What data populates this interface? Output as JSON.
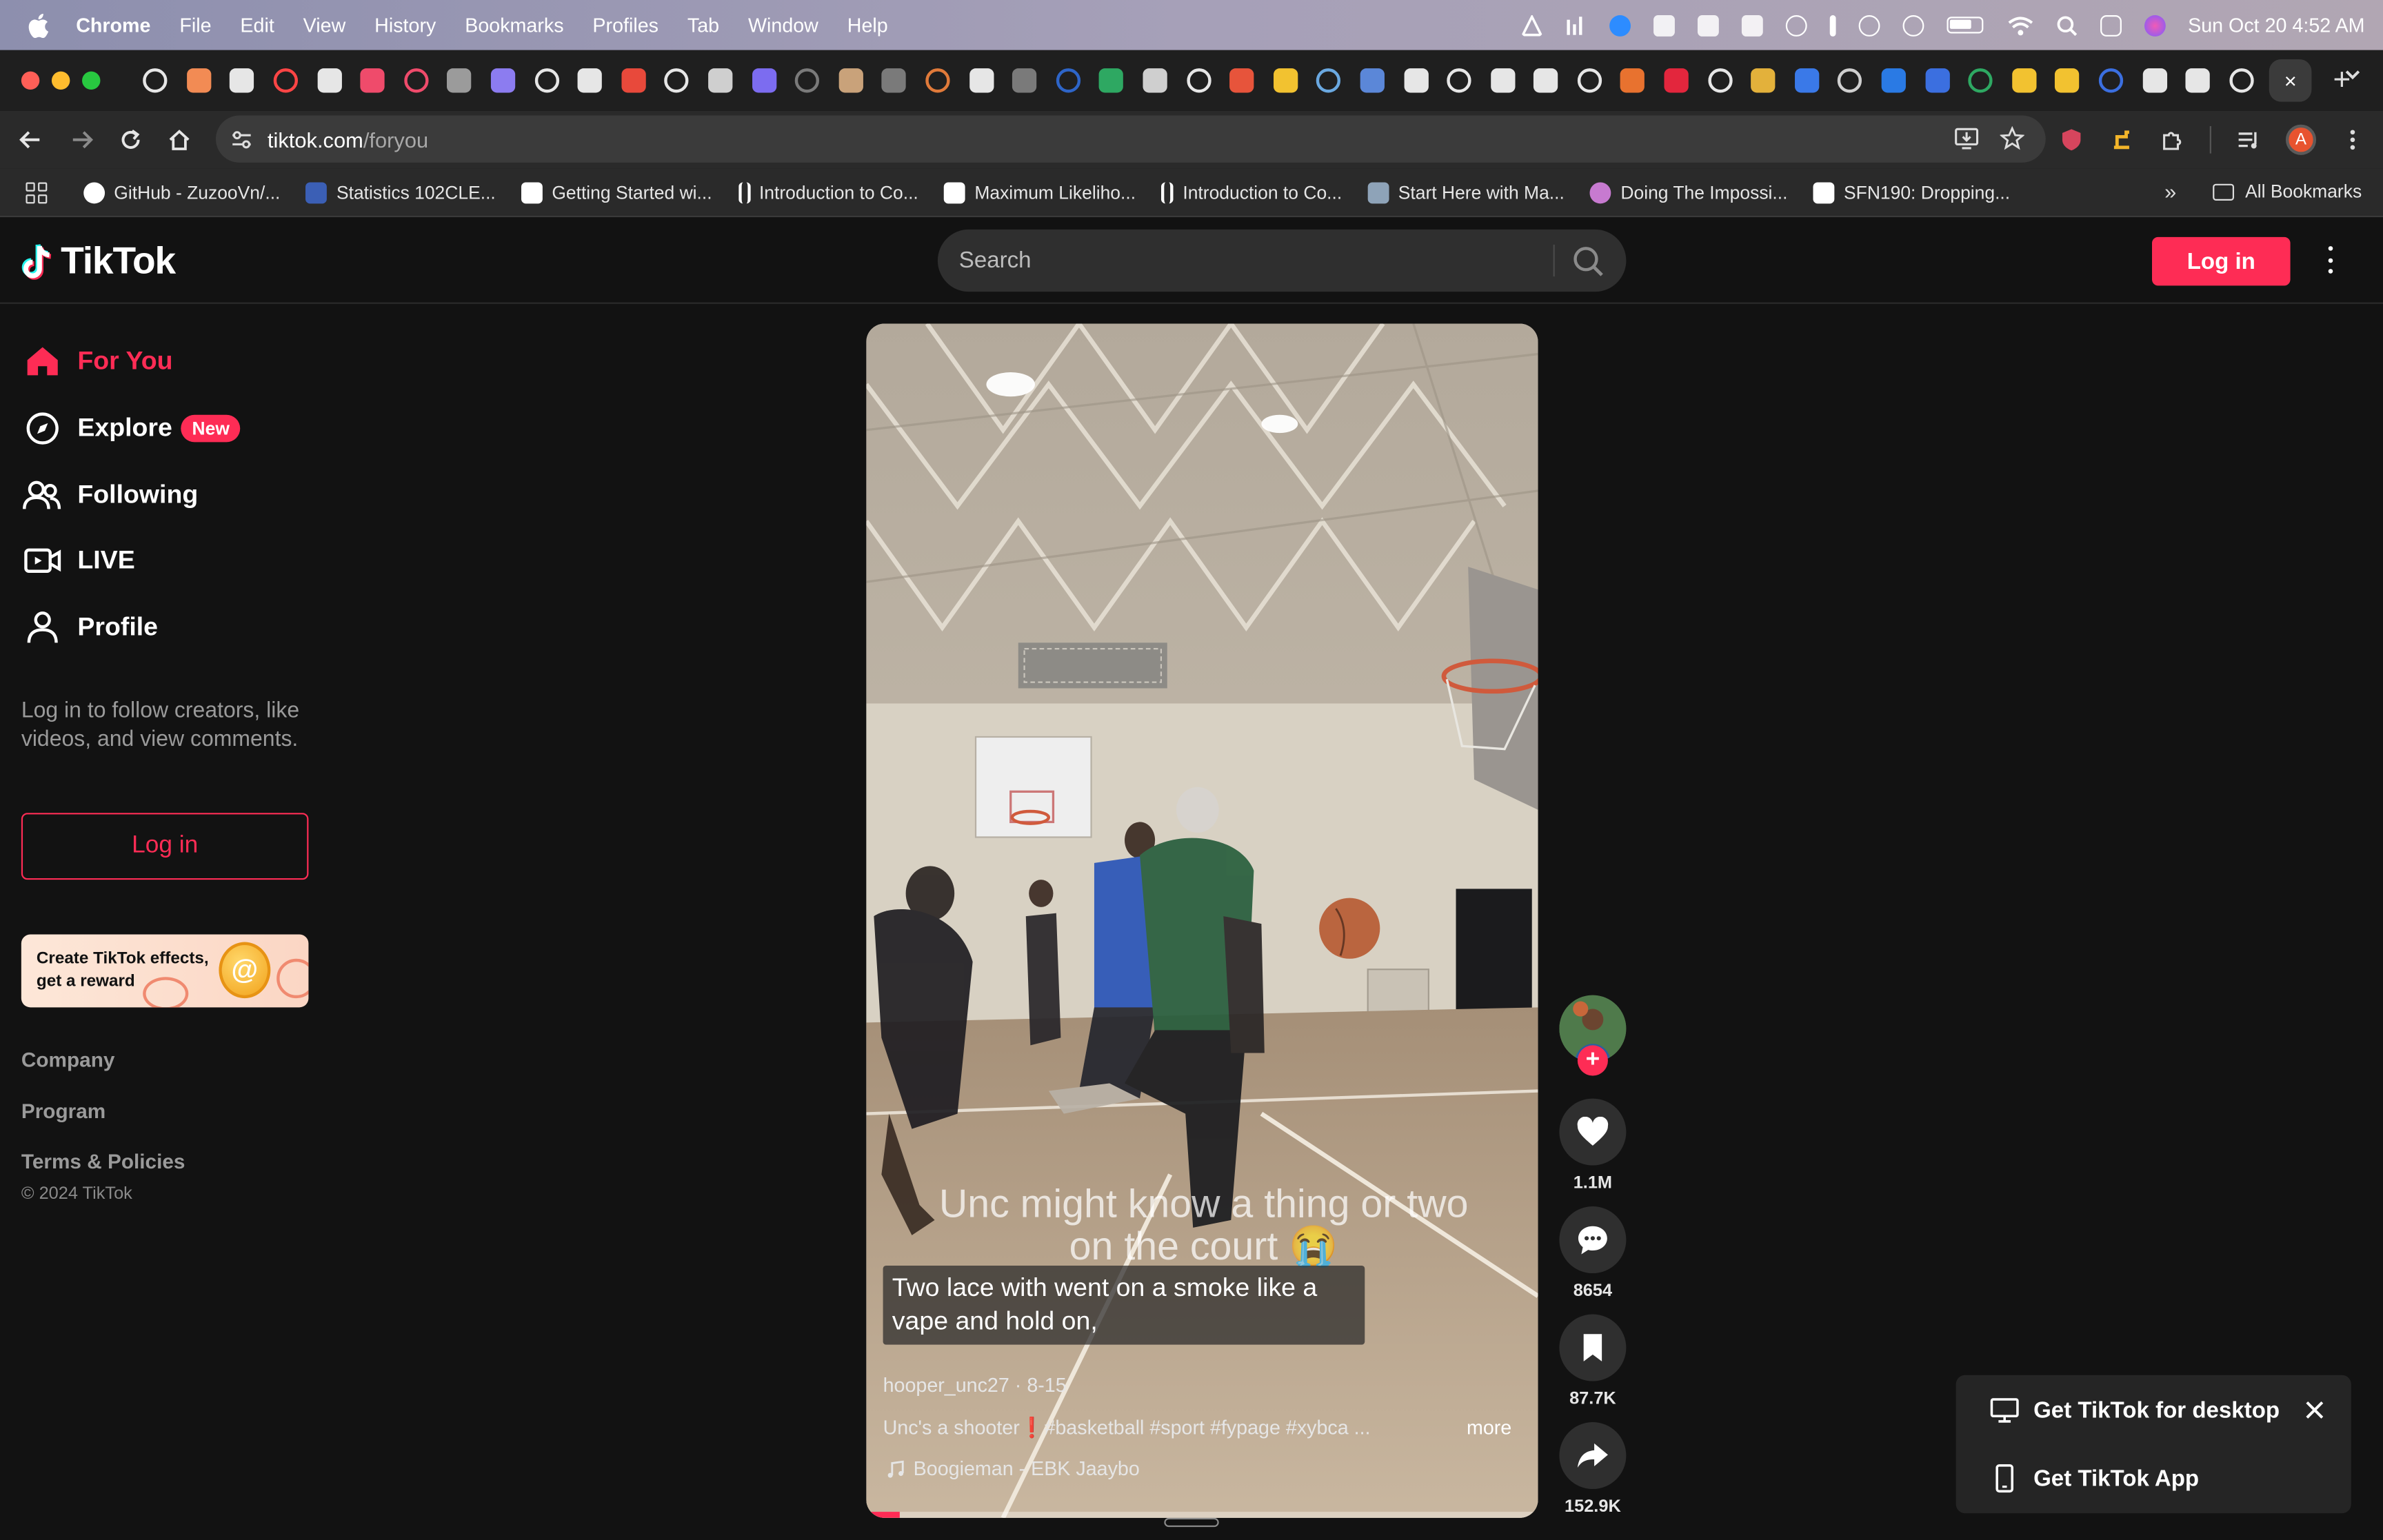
{
  "menubar": {
    "app": "Chrome",
    "items": [
      "File",
      "Edit",
      "View",
      "History",
      "Bookmarks",
      "Profiles",
      "Tab",
      "Window",
      "Help"
    ],
    "clock": "Sun Oct 20  4:52 AM"
  },
  "tabs": {
    "pinned_count": 49,
    "active_close": "×",
    "new_tab": "+"
  },
  "address": {
    "host": "tiktok.com",
    "path": "/foryou"
  },
  "bookmarks": {
    "items": [
      {
        "label": "GitHub - ZuzooVn/...",
        "icon": "github-icon",
        "color": "#ffffff"
      },
      {
        "label": "Statistics 102CLE...",
        "icon": "stats-icon",
        "color": "#3b5fb5"
      },
      {
        "label": "Getting Started wi...",
        "icon": "medium-icon",
        "color": "#ffffff"
      },
      {
        "label": "Introduction to Co...",
        "icon": "bars-icon",
        "color": "#ffffff"
      },
      {
        "label": "Maximum Likeliho...",
        "icon": "chart-icon",
        "color": "#ffffff"
      },
      {
        "label": "Introduction to Co...",
        "icon": "bars-icon",
        "color": "#ffffff"
      },
      {
        "label": "Start Here with Ma...",
        "icon": "image-icon",
        "color": "#8ea3b8"
      },
      {
        "label": "Doing The Impossi...",
        "icon": "globe-icon",
        "color": "#c77ad0"
      },
      {
        "label": "SFN190: Dropping...",
        "icon": "f-icon",
        "color": "#ffffff"
      }
    ],
    "all_label": "All Bookmarks"
  },
  "tiktok": {
    "logo": "TikTok",
    "search_placeholder": "Search",
    "login_label": "Log in",
    "nav": [
      {
        "label": "For You",
        "icon": "home-icon",
        "active": true
      },
      {
        "label": "Explore",
        "icon": "compass-icon",
        "badge": "New"
      },
      {
        "label": "Following",
        "icon": "following-icon"
      },
      {
        "label": "LIVE",
        "icon": "live-icon"
      },
      {
        "label": "Profile",
        "icon": "profile-icon"
      }
    ],
    "login_hint": "Log in to follow creators, like videos, and view comments.",
    "sidebar_login": "Log in",
    "effects_banner": "Create TikTok effects, get a reward",
    "footer": {
      "company": "Company",
      "program": "Program",
      "terms": "Terms & Policies",
      "copyright": "© 2024 TikTok"
    },
    "accent": "#fe2c55"
  },
  "video": {
    "overlay_text": "Unc might know a thing or two on the court 😭",
    "lyric": "Two lace with went on a smoke like a vape and hold on,",
    "author": "hooper_unc27",
    "date": "8-15",
    "description": "Unc's a shooter❗#basketball #sport #fypage #xybca ...",
    "more": "more",
    "music": "Boogieman - EBK Jaaybo",
    "progress": 0.05,
    "likes": "1.1M",
    "comments": "8654",
    "saves": "87.7K",
    "shares": "152.9K"
  },
  "popup": {
    "desktop": "Get TikTok for desktop",
    "app": "Get TikTok App"
  }
}
